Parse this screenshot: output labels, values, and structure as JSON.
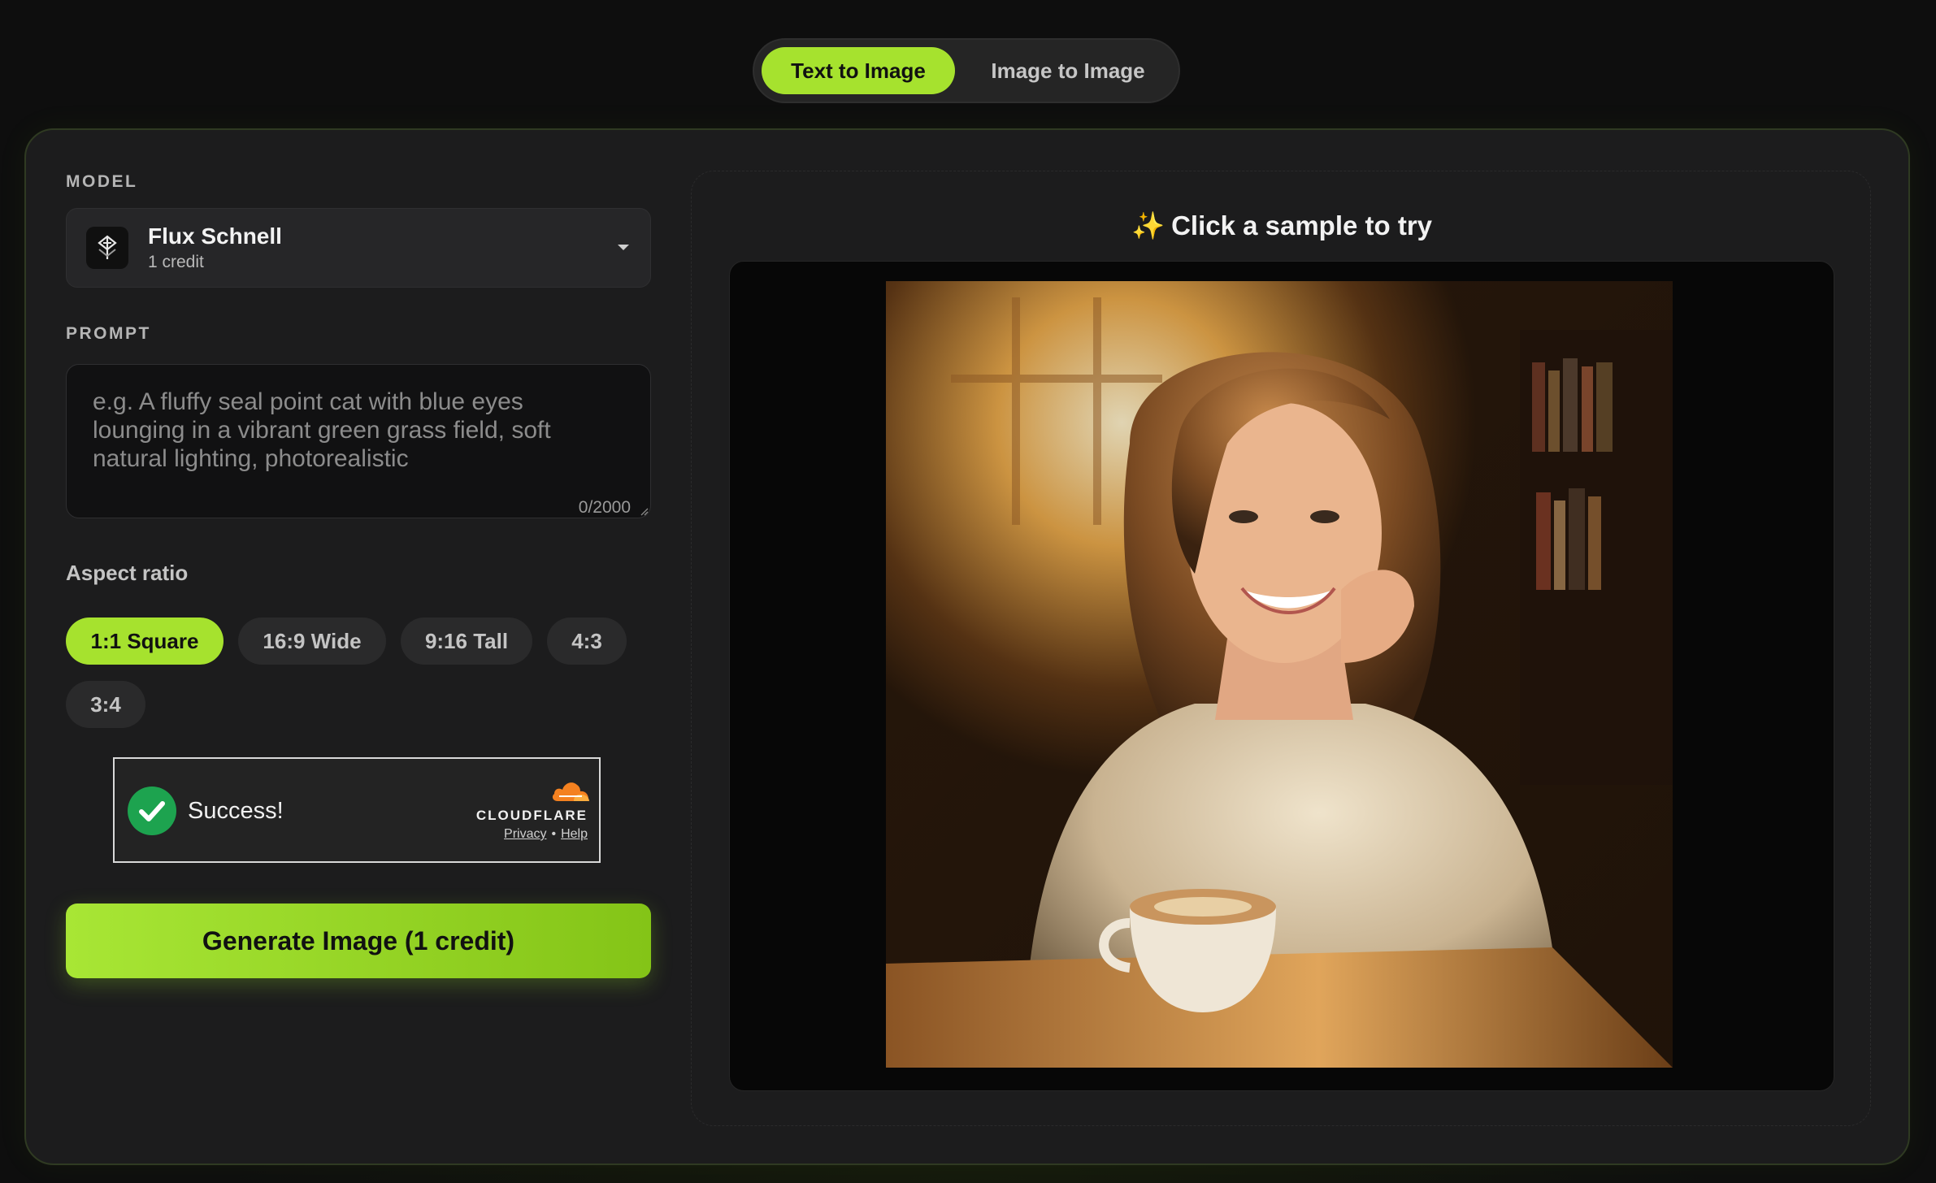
{
  "mode_tabs": {
    "text_to_image": "Text to Image",
    "image_to_image": "Image to Image",
    "active": "Text to Image"
  },
  "model": {
    "section_label": "MODEL",
    "name": "Flux Schnell",
    "credit": "1 credit"
  },
  "prompt": {
    "section_label": "PROMPT",
    "placeholder": "e.g. A fluffy seal point cat with blue eyes lounging in a vibrant green grass field, soft natural lighting, photorealistic",
    "value": "",
    "char_count": "0/2000"
  },
  "aspect_ratio": {
    "label": "Aspect ratio",
    "options": [
      "1:1 Square",
      "16:9 Wide",
      "9:16 Tall",
      "4:3",
      "3:4"
    ],
    "selected": "1:1 Square"
  },
  "captcha": {
    "status": "Success!",
    "provider": "CLOUDFLARE",
    "privacy": "Privacy",
    "separator": "•",
    "help": "Help"
  },
  "generate_button": "Generate Image (1 credit)",
  "preview": {
    "sparkle": "✨",
    "heading": "Click a sample to try"
  },
  "colors": {
    "accent": "#a6e22e",
    "background": "#0e0e0e",
    "panel": "#1c1c1d",
    "captcha_success": "#1da34f",
    "cloudflare_orange": "#f48120"
  }
}
